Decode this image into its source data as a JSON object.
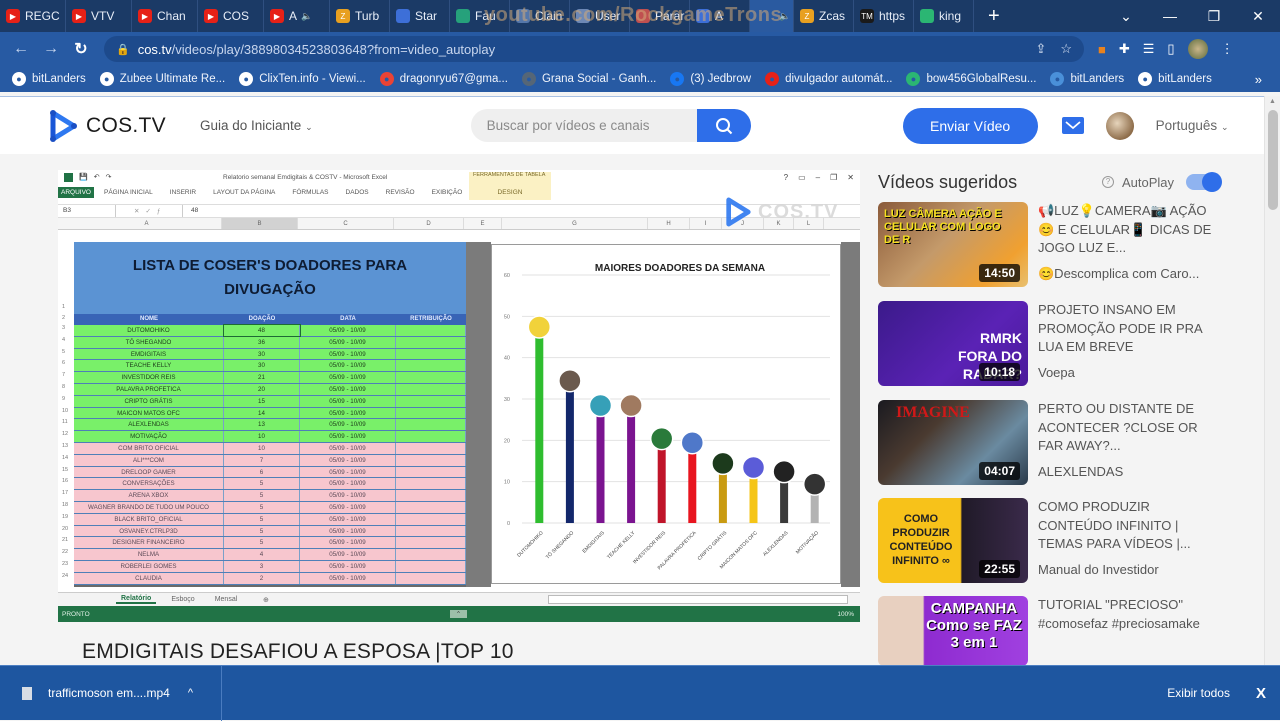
{
  "browser": {
    "tabs": [
      {
        "label": "REGC",
        "icon": "youtube",
        "color": "#e62117"
      },
      {
        "label": "VTV",
        "icon": "youtube",
        "color": "#e62117"
      },
      {
        "label": "Chan",
        "icon": "youtube",
        "color": "#e62117"
      },
      {
        "label": "COS",
        "icon": "youtube",
        "color": "#e62117"
      },
      {
        "label": "A",
        "icon": "youtube",
        "color": "#e62117",
        "audio": true
      },
      {
        "label": "Turb",
        "icon": "zcash",
        "color": "#e8a020"
      },
      {
        "label": "Star",
        "icon": "star",
        "color": "#3d6fd8"
      },
      {
        "label": "Fau",
        "icon": "tether",
        "color": "#26a17b"
      },
      {
        "label": "Clain",
        "icon": "generic",
        "color": "#5577aa"
      },
      {
        "label": "User",
        "icon": "generic",
        "color": "#6d88b5"
      },
      {
        "label": "Parar",
        "icon": "generic",
        "color": "#c05050"
      },
      {
        "label": "A",
        "icon": "generic",
        "color": "#3d6fd8"
      },
      {
        "label": "",
        "icon": "audio",
        "color": "#2a5aa0",
        "active": true,
        "audio": true
      },
      {
        "label": "Zcas",
        "icon": "zcash",
        "color": "#e8a020"
      },
      {
        "label": "https",
        "icon": "tm",
        "color": "#1a1a1a"
      },
      {
        "label": "king",
        "icon": "leaf",
        "color": "#2bb673"
      }
    ],
    "overlay_text": "youtube.com/RockgameTrons",
    "url_host": "cos.tv",
    "url_path": "/videos/play/38898034523803648?from=video_autoplay",
    "bookmarks": [
      {
        "label": "bitLanders",
        "color": "#ffffff"
      },
      {
        "label": "Zubee Ultimate Re...",
        "color": "#ffffff"
      },
      {
        "label": "ClixTen.info - Viewi...",
        "color": "#ffffff"
      },
      {
        "label": "dragonryu67@gma...",
        "color": "#ea4335"
      },
      {
        "label": "Grana Social - Ganh...",
        "color": "#556677"
      },
      {
        "label": "(3) Jedbrow",
        "color": "#1877f2"
      },
      {
        "label": "divulgador automát...",
        "color": "#e62117"
      },
      {
        "label": "bow456GlobalResu...",
        "color": "#2bb673"
      },
      {
        "label": "bitLanders",
        "color": "#4a90d9"
      },
      {
        "label": "bitLanders",
        "color": "#ffffff"
      }
    ],
    "bookmarks_more": "»"
  },
  "site": {
    "logo_text": "COS.TV",
    "guide_label": "Guia do Iniciante",
    "search_placeholder": "Buscar por vídeos e canais",
    "upload_label": "Enviar Vídeo",
    "language": "Português",
    "accent": "#2e6ee9"
  },
  "excel": {
    "window_title": "Relatorio semanal Emdigitais & COSTV - Microsoft Excel",
    "tools_label": "FERRAMENTAS DE TABELA",
    "ribbon": [
      "ARQUIVO",
      "PÁGINA INICIAL",
      "INSERIR",
      "LAYOUT DA PÁGINA",
      "FÓRMULAS",
      "DADOS",
      "REVISÃO",
      "EXIBIÇÃO"
    ],
    "design_tab": "DESIGN",
    "name_box": "B3",
    "formula_value": "48",
    "columns": [
      "A",
      "B",
      "C",
      "D",
      "E",
      "",
      "G",
      "H",
      "I",
      "J",
      "K",
      "L"
    ],
    "banner": "LISTA DE COSER'S DOADORES PARA DIVUGAÇÃO",
    "headers": [
      "NOME",
      "DOAÇÃO",
      "DATA",
      "RETRIBUIÇÃO"
    ],
    "rows": [
      {
        "name": "DUTOMOHIKO",
        "value": "48",
        "date": "05/09 - 10/09",
        "group": "green"
      },
      {
        "name": "TÔ SHEGANDO",
        "value": "36",
        "date": "05/09 - 10/09",
        "group": "green"
      },
      {
        "name": "EMDIGITAIS",
        "value": "30",
        "date": "05/09 - 10/09",
        "group": "green"
      },
      {
        "name": "TEACHE KELLY",
        "value": "30",
        "date": "05/09 - 10/09",
        "group": "green"
      },
      {
        "name": "INVESTIDOR REIS",
        "value": "21",
        "date": "05/09 - 10/09",
        "group": "green"
      },
      {
        "name": "PALAVRA PROFETICA",
        "value": "20",
        "date": "05/09 - 10/09",
        "group": "green"
      },
      {
        "name": "CRIPTO GRÁTIS",
        "value": "15",
        "date": "05/09 - 10/09",
        "group": "green"
      },
      {
        "name": "MAICON MATOS OFC",
        "value": "14",
        "date": "05/09 - 10/09",
        "group": "green"
      },
      {
        "name": "ALEXLENDAS",
        "value": "13",
        "date": "05/09 - 10/09",
        "group": "green"
      },
      {
        "name": "MOTIVAÇÃO",
        "value": "10",
        "date": "05/09 - 10/09",
        "group": "green"
      },
      {
        "name": "COM BRITO OFICIAL",
        "value": "10",
        "date": "05/09 - 10/09",
        "group": "pink"
      },
      {
        "name": "ALI***COM",
        "value": "7",
        "date": "05/09 - 10/09",
        "group": "pink"
      },
      {
        "name": "DRELOOP GAMER",
        "value": "6",
        "date": "05/09 - 10/09",
        "group": "pink"
      },
      {
        "name": "CONVERSAÇÕES",
        "value": "5",
        "date": "05/09 - 10/09",
        "group": "pink"
      },
      {
        "name": "ARENA XBOX",
        "value": "5",
        "date": "05/09 - 10/09",
        "group": "pink"
      },
      {
        "name": "WAGNER BRANDO DE TUDO UM POUCO",
        "value": "5",
        "date": "05/09 - 10/09",
        "group": "pink"
      },
      {
        "name": "BLACK BRITO_OFICIAL",
        "value": "5",
        "date": "05/09 - 10/09",
        "group": "pink"
      },
      {
        "name": "OSVANEY.CTRLP3D",
        "value": "5",
        "date": "05/09 - 10/09",
        "group": "pink"
      },
      {
        "name": "DESIGNER FINANCEIRO",
        "value": "5",
        "date": "05/09 - 10/09",
        "group": "pink"
      },
      {
        "name": "NELMA",
        "value": "4",
        "date": "05/09 - 10/09",
        "group": "pink"
      },
      {
        "name": "ROBERLEI GOMES",
        "value": "3",
        "date": "05/09 - 10/09",
        "group": "pink"
      },
      {
        "name": "CLAUDIA",
        "value": "2",
        "date": "05/09 - 10/09",
        "group": "pink"
      }
    ],
    "sheet_tabs": [
      "Relatório",
      "Esboço",
      "Mensal"
    ],
    "status": "PRONTO",
    "zoom": "100%",
    "watermark": "COS.TV"
  },
  "chart_data": {
    "type": "bar",
    "title": "MAIORES DOADORES DA SEMANA",
    "categories": [
      "DUTOMOHIKO",
      "TÔ SHEGANDO",
      "EMDIGITAIS",
      "TEACHE KELLY",
      "INVESTIDOR REIS",
      "PALAVRA PROFETICA",
      "CRIPTO GRÁTIS",
      "MAICON MATOS OFC",
      "ALEXLENDAS",
      "MOTIVAÇÃO"
    ],
    "values": [
      45,
      32,
      26,
      26,
      18,
      17,
      12,
      11,
      10,
      7
    ],
    "colors": [
      "#2fbd2f",
      "#13276b",
      "#7b1490",
      "#7b1490",
      "#c0152a",
      "#e8151f",
      "#c99b12",
      "#f5c518",
      "#3a3a3a",
      "#b3b3b3"
    ],
    "ylim": [
      0,
      60
    ],
    "yticks": [
      0,
      10,
      20,
      30,
      40,
      50,
      60
    ],
    "xlabel": "",
    "ylabel": "",
    "grid": true,
    "legend": "none"
  },
  "video": {
    "title": "EMDIGITAIS DESAFIOU A ESPOSA |TOP 10"
  },
  "sidebar": {
    "title": "Vídeos sugeridos",
    "autoplay_label": "AutoPlay",
    "autoplay_on": true,
    "videos": [
      {
        "title": "📢LUZ💡CAMERA📷 AÇÃO😊 E CELULAR📱 DICAS DE JOGO LUZ E...",
        "channel": "😊Descomplica com Caro...",
        "duration": "14:50",
        "thumb_text": "LUZ CÂMERA AÇÃO E CELULAR COM LOGO DE R"
      },
      {
        "title": "PROJETO INSANO EM PROMOÇÃO PODE IR PRA LUA EM BREVE",
        "channel": "Voepa",
        "duration": "10:18",
        "thumb_text": "RMRK FORA DO RADAR?"
      },
      {
        "title": "PERTO OU DISTANTE DE ACONTECER ?CLOSE OR FAR AWAY?...",
        "channel": "ALEXLENDAS",
        "duration": "04:07",
        "thumb_text": "IMAGINE"
      },
      {
        "title": "COMO PRODUZIR CONTEÚDO INFINITO | TEMAS PARA VÍDEOS |...",
        "channel": "Manual do Investidor",
        "duration": "22:55",
        "thumb_text": "COMO PRODUZIR CONTEÚDO INFINITO ∞"
      },
      {
        "title": "TUTORIAL \"PRECIOSO\" #comosefaz #preciosamake",
        "channel": "",
        "duration": "",
        "thumb_text": "CAMPANHA Como se FAZ 3 em 1"
      }
    ]
  },
  "downloads": {
    "file": "trafficmoson em....mp4",
    "show_all": "Exibir todos",
    "close": "X"
  }
}
